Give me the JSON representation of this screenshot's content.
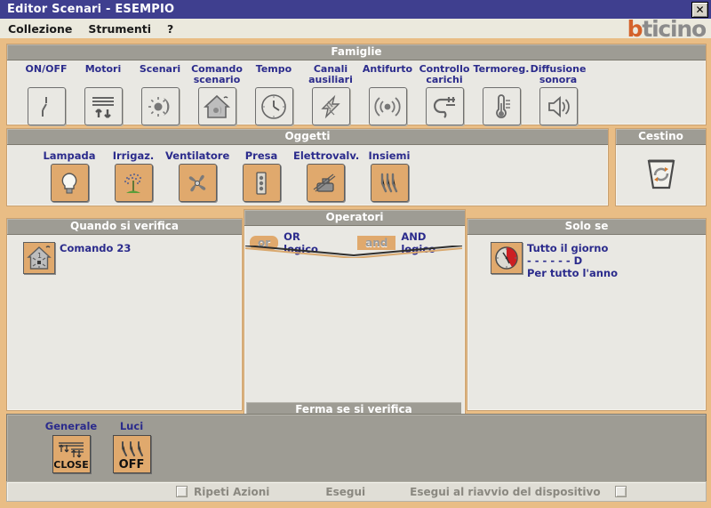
{
  "window": {
    "title": "Editor Scenari - ESEMPIO",
    "close_label": "✕",
    "brand_first": "b",
    "brand_rest": "ticino"
  },
  "menu": {
    "items": [
      {
        "label": "Collezione"
      },
      {
        "label": "Strumenti"
      },
      {
        "label": "?"
      }
    ]
  },
  "famiglie": {
    "title": "Famiglie",
    "items": [
      {
        "label": "ON/OFF",
        "icon": "switch-icon"
      },
      {
        "label": "Motori",
        "icon": "shutter-updown-icon"
      },
      {
        "label": "Scenari",
        "icon": "scenario-sun-icon"
      },
      {
        "label": "Comando\nscenario",
        "icon": "house-scenario-icon"
      },
      {
        "label": "Tempo",
        "icon": "clock-icon"
      },
      {
        "label": "Canali\nausiliari",
        "icon": "lightning-icon"
      },
      {
        "label": "Antifurto",
        "icon": "alarm-waves-icon"
      },
      {
        "label": "Controllo\ncarichi",
        "icon": "plug-icon"
      },
      {
        "label": "Termoreg.",
        "icon": "thermometer-icon"
      },
      {
        "label": "Diffusione\nsonora",
        "icon": "speaker-icon"
      }
    ]
  },
  "oggetti": {
    "title": "Oggetti",
    "items": [
      {
        "label": "Lampada",
        "icon": "lightbulb-icon"
      },
      {
        "label": "Irrigaz.",
        "icon": "sprinkler-icon"
      },
      {
        "label": "Ventilatore",
        "icon": "fan-icon"
      },
      {
        "label": "Presa",
        "icon": "socket-icon"
      },
      {
        "label": "Elettrovalv.",
        "icon": "solenoid-valve-icon"
      },
      {
        "label": "Insiemi",
        "icon": "groups-icon"
      }
    ]
  },
  "cestino": {
    "title": "Cestino",
    "icon": "trash-recycle-icon"
  },
  "quando": {
    "title": "Quando si verifica",
    "entries": [
      {
        "icon": "house-command-icon",
        "lines": [
          "Comando 23"
        ]
      }
    ]
  },
  "operatori": {
    "title": "Operatori",
    "footer": "Ferma se si verifica",
    "operators": [
      {
        "badge": "or",
        "label": "OR logico",
        "shape": "round"
      },
      {
        "badge": "and",
        "label": "AND logico",
        "shape": "square"
      }
    ]
  },
  "solose": {
    "title": "Solo se",
    "entries": [
      {
        "icon": "clock-pie-icon",
        "lines": [
          "Tutto il giorno",
          "-  -  -  -  -  - D",
          "Per tutto l'anno"
        ]
      }
    ]
  },
  "azioni": {
    "items": [
      {
        "label": "Generale",
        "icon": "shutter-close-icon",
        "caption": "CLOSE"
      },
      {
        "label": "Luci",
        "icon": "lights-off-icon",
        "caption": "OFF"
      }
    ]
  },
  "statusbar": {
    "ripeti_label": "Ripeti Azioni",
    "ripeti_checked": false,
    "esegui_label": "Esegui",
    "riavvio_label": "Esegui al riavvio del dispositivo",
    "riavvio_checked": false
  },
  "colors": {
    "window_bg": "#e9bd85",
    "titlebar": "#3f3f8f",
    "panel_head": "#9e9c94",
    "panel_body": "#e9e8e3",
    "label_blue": "#2b2b8c",
    "object_tile": "#e0a96d",
    "brand_orange": "#d4622a",
    "brand_gray": "#8b8b8b"
  }
}
